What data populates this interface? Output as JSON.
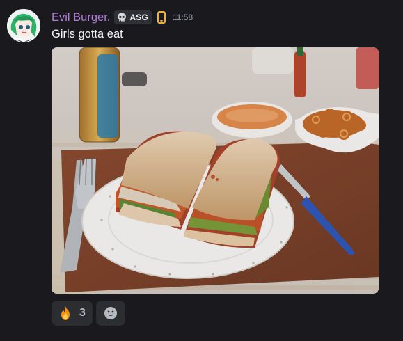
{
  "message": {
    "author": {
      "display_name": "Evil Burger.",
      "name_color": "#b07ad9",
      "avatar_icon": "anime-character-avatar"
    },
    "guild_tag": {
      "icon": "skull-icon",
      "text": "ASG"
    },
    "platform_icon": "mobile-phone-icon",
    "timestamp": "11:58",
    "content": "Girls gotta eat",
    "attachment": {
      "type": "image",
      "subject": "sandwich-on-plate-photo"
    },
    "reactions": [
      {
        "emoji": "fire-emoji",
        "count": "3"
      }
    ],
    "add_reaction_icon": "smiley-add-reaction-icon"
  },
  "colors": {
    "background": "#1a1a1e",
    "text": "#f2f3f5",
    "muted": "#949ba4",
    "pill": "#2b2d31"
  }
}
